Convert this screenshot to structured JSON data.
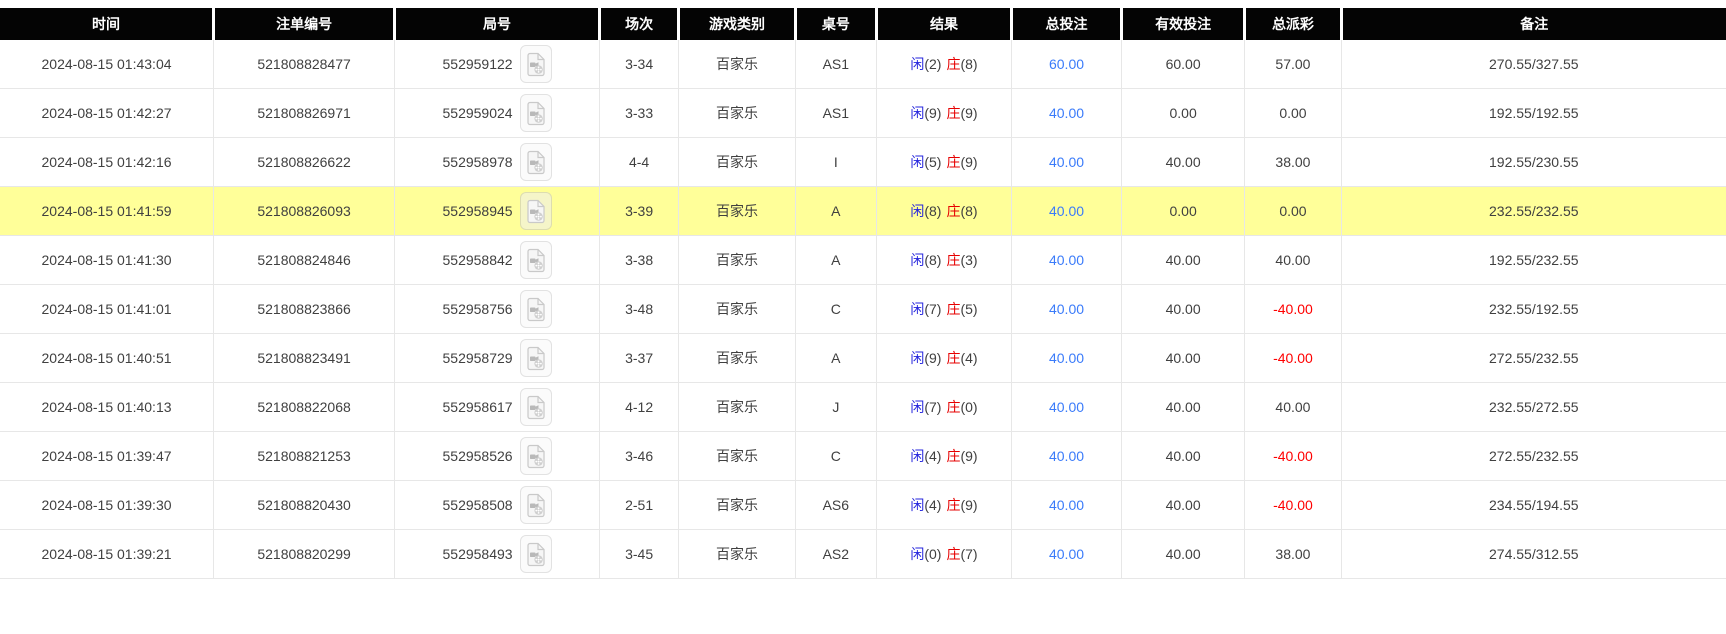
{
  "colors": {
    "header_bg": "#040404",
    "header_text": "#ffffff",
    "highlight_row": "#ffff99",
    "player_blue": "#2525dd",
    "banker_red": "#e60000",
    "amount_blue": "#3a7bfa",
    "negative_red": "#ff0000",
    "text": "#404040",
    "grid_border": "#e7e7e7"
  },
  "icons": {
    "round_video_icon": "video-file-icon"
  },
  "table": {
    "columns": [
      {
        "key": "time",
        "label": "时间"
      },
      {
        "key": "bet_id",
        "label": "注单编号"
      },
      {
        "key": "round",
        "label": "局号"
      },
      {
        "key": "session",
        "label": "场次"
      },
      {
        "key": "game",
        "label": "游戏类别"
      },
      {
        "key": "table_no",
        "label": "桌号"
      },
      {
        "key": "result",
        "label": "结果"
      },
      {
        "key": "total_bet",
        "label": "总投注"
      },
      {
        "key": "valid_bet",
        "label": "有效投注"
      },
      {
        "key": "payout",
        "label": "总派彩"
      },
      {
        "key": "remark",
        "label": "备注"
      }
    ],
    "rows": [
      {
        "time": "2024-08-15 01:43:04",
        "bet_id": "521808828477",
        "round_id": "552959122",
        "session": "3-34",
        "game_type": "百家乐",
        "table_no": "AS1",
        "result": {
          "player": "闲",
          "player_score": "(2)",
          "banker": "庄",
          "banker_score": "(8)"
        },
        "total_bet": "60.00",
        "valid_bet": "60.00",
        "payout": "57.00",
        "remark": "270.55/327.55",
        "highlighted": false
      },
      {
        "time": "2024-08-15 01:42:27",
        "bet_id": "521808826971",
        "round_id": "552959024",
        "session": "3-33",
        "game_type": "百家乐",
        "table_no": "AS1",
        "result": {
          "player": "闲",
          "player_score": "(9)",
          "banker": "庄",
          "banker_score": "(9)"
        },
        "total_bet": "40.00",
        "valid_bet": "0.00",
        "payout": "0.00",
        "remark": "192.55/192.55",
        "highlighted": false
      },
      {
        "time": "2024-08-15 01:42:16",
        "bet_id": "521808826622",
        "round_id": "552958978",
        "session": "4-4",
        "game_type": "百家乐",
        "table_no": "I",
        "result": {
          "player": "闲",
          "player_score": "(5)",
          "banker": "庄",
          "banker_score": "(9)"
        },
        "total_bet": "40.00",
        "valid_bet": "40.00",
        "payout": "38.00",
        "remark": "192.55/230.55",
        "highlighted": false
      },
      {
        "time": "2024-08-15 01:41:59",
        "bet_id": "521808826093",
        "round_id": "552958945",
        "session": "3-39",
        "game_type": "百家乐",
        "table_no": "A",
        "result": {
          "player": "闲",
          "player_score": "(8)",
          "banker": "庄",
          "banker_score": "(8)"
        },
        "total_bet": "40.00",
        "valid_bet": "0.00",
        "payout": "0.00",
        "remark": "232.55/232.55",
        "highlighted": true
      },
      {
        "time": "2024-08-15 01:41:30",
        "bet_id": "521808824846",
        "round_id": "552958842",
        "session": "3-38",
        "game_type": "百家乐",
        "table_no": "A",
        "result": {
          "player": "闲",
          "player_score": "(8)",
          "banker": "庄",
          "banker_score": "(3)"
        },
        "total_bet": "40.00",
        "valid_bet": "40.00",
        "payout": "40.00",
        "remark": "192.55/232.55",
        "highlighted": false
      },
      {
        "time": "2024-08-15 01:41:01",
        "bet_id": "521808823866",
        "round_id": "552958756",
        "session": "3-48",
        "game_type": "百家乐",
        "table_no": "C",
        "result": {
          "player": "闲",
          "player_score": "(7)",
          "banker": "庄",
          "banker_score": "(5)"
        },
        "total_bet": "40.00",
        "valid_bet": "40.00",
        "payout": "-40.00",
        "remark": "232.55/192.55",
        "highlighted": false
      },
      {
        "time": "2024-08-15 01:40:51",
        "bet_id": "521808823491",
        "round_id": "552958729",
        "session": "3-37",
        "game_type": "百家乐",
        "table_no": "A",
        "result": {
          "player": "闲",
          "player_score": "(9)",
          "banker": "庄",
          "banker_score": "(4)"
        },
        "total_bet": "40.00",
        "valid_bet": "40.00",
        "payout": "-40.00",
        "remark": "272.55/232.55",
        "highlighted": false
      },
      {
        "time": "2024-08-15 01:40:13",
        "bet_id": "521808822068",
        "round_id": "552958617",
        "session": "4-12",
        "game_type": "百家乐",
        "table_no": "J",
        "result": {
          "player": "闲",
          "player_score": "(7)",
          "banker": "庄",
          "banker_score": "(0)"
        },
        "total_bet": "40.00",
        "valid_bet": "40.00",
        "payout": "40.00",
        "remark": "232.55/272.55",
        "highlighted": false
      },
      {
        "time": "2024-08-15 01:39:47",
        "bet_id": "521808821253",
        "round_id": "552958526",
        "session": "3-46",
        "game_type": "百家乐",
        "table_no": "C",
        "result": {
          "player": "闲",
          "player_score": "(4)",
          "banker": "庄",
          "banker_score": "(9)"
        },
        "total_bet": "40.00",
        "valid_bet": "40.00",
        "payout": "-40.00",
        "remark": "272.55/232.55",
        "highlighted": false
      },
      {
        "time": "2024-08-15 01:39:30",
        "bet_id": "521808820430",
        "round_id": "552958508",
        "session": "2-51",
        "game_type": "百家乐",
        "table_no": "AS6",
        "result": {
          "player": "闲",
          "player_score": "(4)",
          "banker": "庄",
          "banker_score": "(9)"
        },
        "total_bet": "40.00",
        "valid_bet": "40.00",
        "payout": "-40.00",
        "remark": "234.55/194.55",
        "highlighted": false
      },
      {
        "time": "2024-08-15 01:39:21",
        "bet_id": "521808820299",
        "round_id": "552958493",
        "session": "3-45",
        "game_type": "百家乐",
        "table_no": "AS2",
        "result": {
          "player": "闲",
          "player_score": "(0)",
          "banker": "庄",
          "banker_score": "(7)"
        },
        "total_bet": "40.00",
        "valid_bet": "40.00",
        "payout": "38.00",
        "remark": "274.55/312.55",
        "highlighted": false
      }
    ]
  }
}
